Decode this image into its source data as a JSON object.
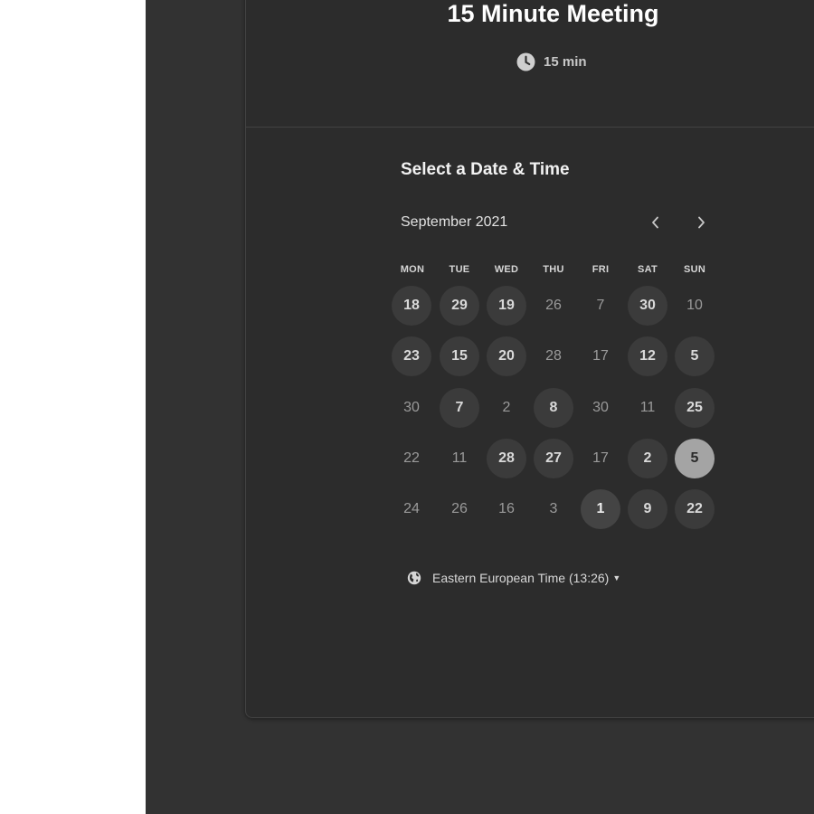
{
  "event": {
    "title": "15 Minute Meeting",
    "duration": "15 min",
    "duration_icon": "clock-icon"
  },
  "calendar": {
    "heading": "Select a Date & Time",
    "month_label": "September 2021",
    "prev_icon": "chevron-left-icon",
    "next_icon": "chevron-right-icon",
    "weekdays": [
      "MON",
      "TUE",
      "WED",
      "THU",
      "FRI",
      "SAT",
      "SUN"
    ],
    "weeks": [
      [
        {
          "d": "18",
          "avail": true
        },
        {
          "d": "29",
          "avail": true
        },
        {
          "d": "19",
          "avail": true
        },
        {
          "d": "26",
          "avail": false
        },
        {
          "d": "7",
          "avail": false
        },
        {
          "d": "30",
          "avail": true
        },
        {
          "d": "10",
          "avail": false
        }
      ],
      [
        {
          "d": "23",
          "avail": true
        },
        {
          "d": "15",
          "avail": true
        },
        {
          "d": "20",
          "avail": true
        },
        {
          "d": "28",
          "avail": false
        },
        {
          "d": "17",
          "avail": false
        },
        {
          "d": "12",
          "avail": true
        },
        {
          "d": "5",
          "avail": true
        }
      ],
      [
        {
          "d": "30",
          "avail": false
        },
        {
          "d": "7",
          "avail": true
        },
        {
          "d": "2",
          "avail": false
        },
        {
          "d": "8",
          "avail": true
        },
        {
          "d": "30",
          "avail": false
        },
        {
          "d": "11",
          "avail": false
        },
        {
          "d": "25",
          "avail": true
        }
      ],
      [
        {
          "d": "22",
          "avail": false
        },
        {
          "d": "11",
          "avail": false
        },
        {
          "d": "28",
          "avail": true
        },
        {
          "d": "27",
          "avail": true
        },
        {
          "d": "17",
          "avail": false
        },
        {
          "d": "2",
          "avail": true
        },
        {
          "d": "5",
          "avail": true,
          "selected": true
        }
      ],
      [
        {
          "d": "24",
          "avail": false
        },
        {
          "d": "26",
          "avail": false
        },
        {
          "d": "16",
          "avail": false
        },
        {
          "d": "3",
          "avail": false
        },
        {
          "d": "1",
          "avail": true,
          "strong": true
        },
        {
          "d": "9",
          "avail": true
        },
        {
          "d": "22",
          "avail": true
        }
      ]
    ]
  },
  "timezone": {
    "label": "Eastern European Time (13:26)",
    "icon": "globe-icon"
  },
  "colors": {
    "background": "#323232",
    "card": "#2c2c2c",
    "available_day": "#3b3b3b",
    "selected_day": "#a4a4a4"
  }
}
